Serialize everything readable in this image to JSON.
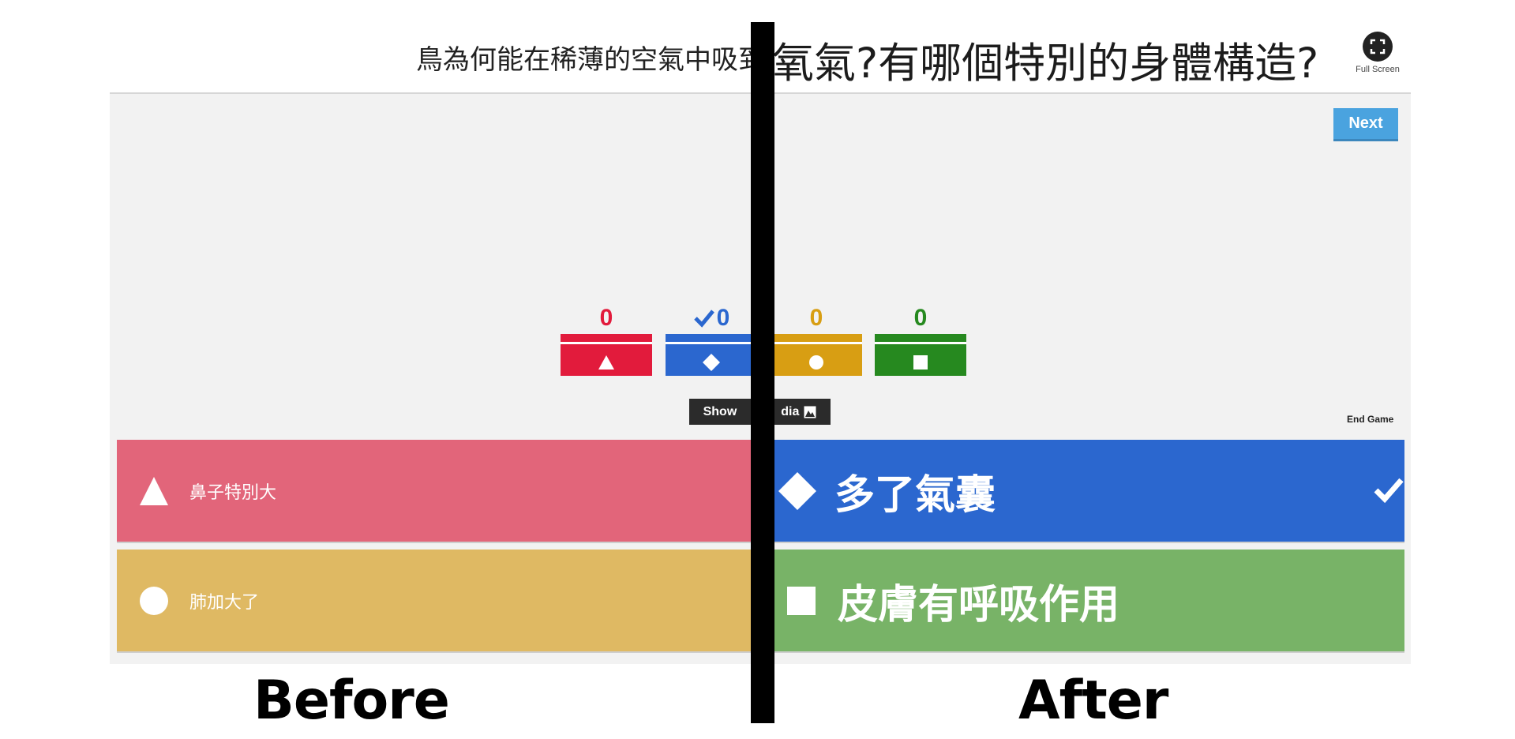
{
  "question": {
    "before_text": "鳥為何能在稀薄的空氣中吸到",
    "after_text": "氧氣?有哪個特別的身體構造?"
  },
  "fullscreen": {
    "label": "Full Screen",
    "icon": "fullscreen-icon"
  },
  "next_button": {
    "label": "Next",
    "color": "#4aa3df"
  },
  "results": [
    {
      "count": "0",
      "shape": "triangle-icon",
      "color": "#e21b3c",
      "correct": false
    },
    {
      "count": "0",
      "shape": "diamond-icon",
      "color": "#2b67cf",
      "correct": true
    },
    {
      "count": "0",
      "shape": "circle-icon",
      "color": "#d89e13",
      "correct": false
    },
    {
      "count": "0",
      "shape": "square-icon",
      "color": "#26891f",
      "correct": false
    }
  ],
  "show_media": {
    "label_left": "Show",
    "label_right": "dia",
    "icon": "image-icon"
  },
  "end_game": "End Game",
  "answers": [
    {
      "label": "鼻子特別大",
      "shape": "triangle-icon",
      "color": "#e2657a"
    },
    {
      "label": "多了氣囊",
      "shape": "diamond-icon",
      "color": "#2b67cf",
      "correct": true
    },
    {
      "label": "肺加大了",
      "shape": "circle-icon",
      "color": "#dfb963"
    },
    {
      "label": "皮膚有呼吸作用",
      "shape": "square-icon",
      "color": "#78b367"
    }
  ],
  "captions": {
    "before": "Before",
    "after": "After"
  }
}
